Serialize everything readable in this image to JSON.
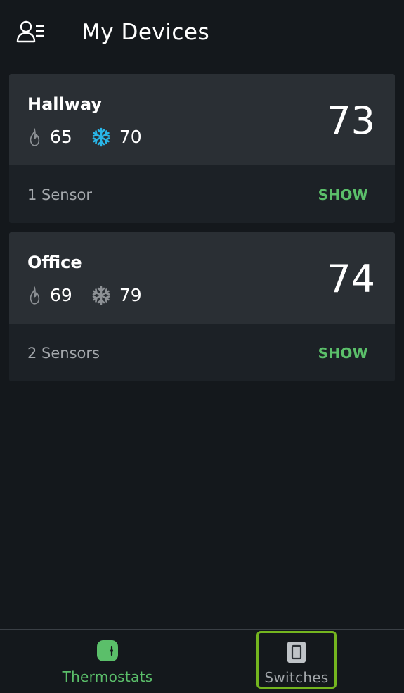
{
  "header": {
    "title": "My Devices",
    "profile_icon": "user-list-icon"
  },
  "devices": [
    {
      "name": "Hallway",
      "heat_setpoint": "65",
      "cool_setpoint": "70",
      "current_temp": "73",
      "sensors": "1 Sensor",
      "show_label": "SHOW",
      "cool_active": true
    },
    {
      "name": "Office",
      "heat_setpoint": "69",
      "cool_setpoint": "79",
      "current_temp": "74",
      "sensors": "2 Sensors",
      "show_label": "SHOW",
      "cool_active": false
    }
  ],
  "bottom_nav": {
    "tabs": [
      {
        "label": "Thermostats",
        "icon": "thermostat-icon",
        "active": true
      },
      {
        "label": "Switches",
        "icon": "light-switch-icon",
        "active": false
      }
    ]
  },
  "colors": {
    "background": "#14181c",
    "card_top": "#2a2f34",
    "card_bottom": "#1c2126",
    "accent_green": "#5bbf6a",
    "cool_active": "#29b6e8",
    "cool_inactive": "#8d9195",
    "highlight_border": "#74b51f"
  }
}
